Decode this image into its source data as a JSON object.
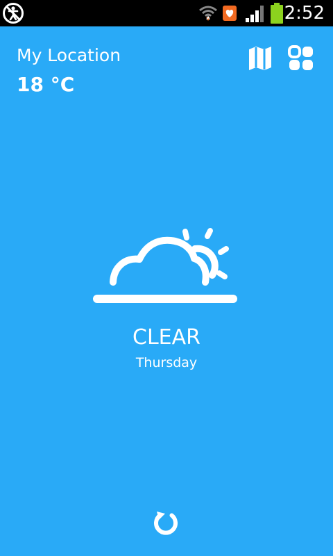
{
  "status_bar": {
    "time": "2:52",
    "icons": [
      "accessibility-off-icon",
      "wifi-icon",
      "notification-heart-icon",
      "signal-icon",
      "battery-icon"
    ]
  },
  "header": {
    "location": "My Location",
    "temperature": "18 °C"
  },
  "toolbar": {
    "icons": [
      "map-icon",
      "apps-grid-icon"
    ]
  },
  "weather": {
    "icon": "cloud-sun-icon",
    "condition": "CLEAR",
    "day": "Thursday"
  },
  "actions": {
    "refresh_icon": "refresh-icon"
  },
  "colors": {
    "background": "#29aaf7",
    "status_bar": "#000000",
    "foreground": "#ffffff",
    "notification_badge": "#f26a21",
    "battery_fill": "#8cd21e"
  }
}
